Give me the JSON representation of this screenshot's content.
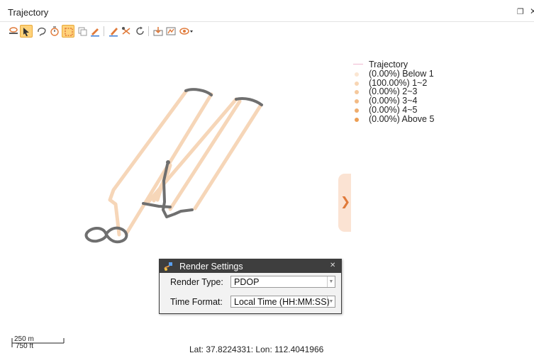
{
  "window": {
    "title": "Trajectory",
    "restore_icon": "restore-window-icon",
    "close_icon": "close-icon"
  },
  "toolbar": {
    "tools": [
      {
        "name": "layer-icon",
        "active": false
      },
      {
        "name": "select-arrow-icon",
        "active": true
      },
      {
        "name": "lasso-select-icon",
        "active": false
      },
      {
        "name": "timer-select-icon",
        "active": false
      },
      {
        "name": "rectangle-select-icon",
        "active": true
      },
      {
        "name": "copy-icon",
        "active": false
      },
      {
        "name": "edit-pencil-icon",
        "active": false
      },
      {
        "name": "brush-icon",
        "active": false
      },
      {
        "name": "split-icon",
        "active": false
      },
      {
        "name": "refresh-icon",
        "active": false
      },
      {
        "name": "import-icon",
        "active": false
      },
      {
        "name": "map-export-icon",
        "active": false
      },
      {
        "name": "eye-dropdown-icon",
        "active": false
      }
    ]
  },
  "legend": {
    "title": "Trajectory",
    "items": [
      {
        "label": "(0.00%) Below 1",
        "color": "#fbe6d2"
      },
      {
        "label": "(100.00%) 1~2",
        "color": "#f8d6b4"
      },
      {
        "label": "(0.00%) 2~3",
        "color": "#f5c89c"
      },
      {
        "label": "(0.00%) 3~4",
        "color": "#f2ba84"
      },
      {
        "label": "(0.00%) 4~5",
        "color": "#efac6c"
      },
      {
        "label": "(0.00%) Above 5",
        "color": "#ec9e54"
      }
    ]
  },
  "side_panel": {
    "icon": "chevron-right-icon"
  },
  "render_settings": {
    "title": "Render Settings",
    "render_type_label": "Render Type:",
    "render_type_value": "PDOP",
    "time_format_label": "Time Format:",
    "time_format_value": "Local Time (HH:MM:SS)"
  },
  "scalebar": {
    "metric": "250 m",
    "imperial": "750 ft"
  },
  "status": {
    "coordinates": "Lat: 37.8224331: Lon: 112.4041966"
  },
  "colors": {
    "track": "#f6d6b8",
    "gap": "#6f6f6f",
    "accent": "#e07a3a"
  }
}
